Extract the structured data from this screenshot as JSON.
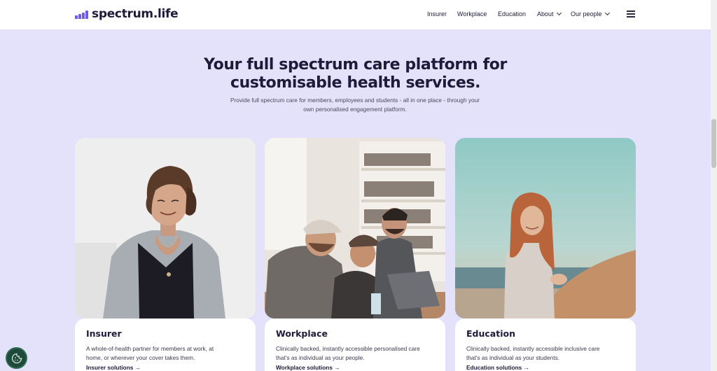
{
  "header": {
    "logo_text": "spectrum.life",
    "nav": [
      {
        "label": "Insurer",
        "has_dropdown": false
      },
      {
        "label": "Workplace",
        "has_dropdown": false
      },
      {
        "label": "Education",
        "has_dropdown": false
      },
      {
        "label": "About",
        "has_dropdown": true
      },
      {
        "label": "Our people",
        "has_dropdown": true
      }
    ],
    "menu_icon": "hamburger-menu-icon"
  },
  "hero": {
    "title_line1": "Your full spectrum care platform for",
    "title_line2": "customisable health services.",
    "subtitle_line1": "Provide full spectrum care for members, employees and students - all in one place - through your",
    "subtitle_line2": "own personalised engagement platform."
  },
  "cards": [
    {
      "title": "Insurer",
      "desc_line1": "A whole-of-health partner for members at work, at",
      "desc_line2": "home, or wherever your cover takes them.",
      "more": "Insurer solutions →",
      "image": "woman-smiling-looking-down-photo"
    },
    {
      "title": "Workplace",
      "desc_line1": "Clinically backed, instantly accessible personalised care",
      "desc_line2": "that's as individual as your people.",
      "more": "Workplace solutions →",
      "image": "colleagues-laughing-at-laptop-photo"
    },
    {
      "title": "Education",
      "desc_line1": "Clinically backed, instantly accessible inclusive care",
      "desc_line2": "that's as individual as your students.",
      "more": "Education solutions →",
      "image": "woman-with-surfboard-on-beach-photo"
    }
  ],
  "colors": {
    "background": "#e4e1fb",
    "brand": "#6c5ce7",
    "text_dark": "#1e1b3a",
    "cookie_button": "#1f4a3a"
  },
  "cookie_icon": "cookie-icon"
}
